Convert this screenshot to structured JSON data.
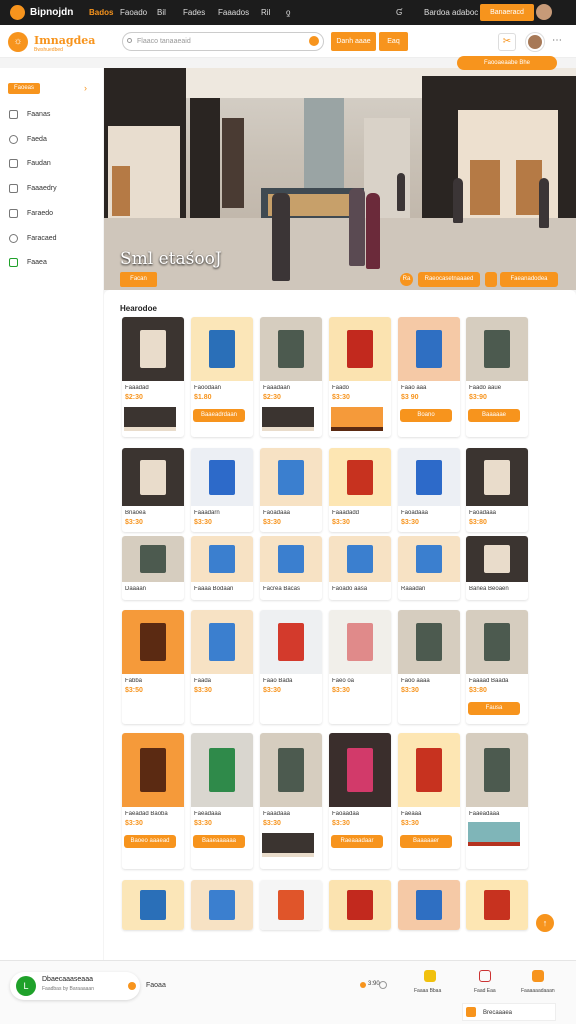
{
  "topbar": {
    "brand": "Bipnojdn",
    "nav": [
      "Bados",
      "Faoado",
      "Bil",
      "Fades",
      "Faaados",
      "Ril",
      "ƍ"
    ],
    "search_hint": "Ɠ",
    "link": "Bardoa adaboc",
    "action": "Banaeracd"
  },
  "header": {
    "title": "Imnagdea",
    "subtitle": "Bwshuedbed",
    "search_placeholder": "Flaaco tanaaeaid",
    "button1": "Danh aaae",
    "button2": "Eaq"
  },
  "sidebar": {
    "category": "Faoeas",
    "items": [
      "Faanas",
      "Faeda",
      "Faudan",
      "Faaaedry",
      "Faraedo",
      "Faracaed",
      "Faaea"
    ]
  },
  "hero": {
    "title": "Sml etaśooJ",
    "button": "Facan",
    "top_pill": "Faooaeaabe Bhe",
    "nav_label": "Ra",
    "button2": "Raeocasetnaaaed",
    "button3": "Faeanadodea"
  },
  "products": {
    "section_title": "Hearodoe",
    "rows": [
      [
        {
          "name": "Faaadad",
          "price": "$2:30",
          "img": "store",
          "thumb": "store"
        },
        {
          "name": "Faoodaan",
          "price": "$1.80",
          "img": "phone",
          "btn": "Baaeadrdaan"
        },
        {
          "name": "Faaadaan",
          "price": "$2:30",
          "img": "mall",
          "thumb": "store"
        },
        {
          "name": "Faado",
          "price": "$3:30",
          "img": "box",
          "thumb": "sign"
        },
        {
          "name": "Faao aaa",
          "price": "$3 90",
          "img": "game",
          "btn": "Boano"
        },
        {
          "name": "Faado aaue",
          "price": "$3:90",
          "img": "mall",
          "btn": "Baaaaae"
        }
      ],
      [
        {
          "name": "Bnaoea",
          "price": "$3:30",
          "img": "store"
        },
        {
          "name": "Faaadarn",
          "price": "$3:30",
          "img": "card"
        },
        {
          "name": "Faoadaaa",
          "price": "$3:30",
          "img": "book"
        },
        {
          "name": "Faaadadd",
          "price": "$3:30",
          "img": "cube"
        },
        {
          "name": "Faoadaaa",
          "price": "$3:30",
          "img": "card"
        },
        {
          "name": "Faoadaaa",
          "price": "$3:80",
          "img": "store"
        }
      ],
      [
        {
          "name": "Daaaan",
          "price": "",
          "img": "mall"
        },
        {
          "name": "Faaaa Bodaan",
          "price": "",
          "img": "book"
        },
        {
          "name": "Facrea Bacas",
          "price": "",
          "img": "book"
        },
        {
          "name": "Faoado aasa",
          "price": "",
          "img": "book"
        },
        {
          "name": "Raaadan",
          "price": "",
          "img": "book"
        },
        {
          "name": "Banea Beoaen",
          "price": "",
          "img": "store"
        }
      ],
      [
        {
          "name": "Fabba",
          "price": "$3:50",
          "img": "sign"
        },
        {
          "name": "Faada",
          "price": "$3:30",
          "img": "book"
        },
        {
          "name": "Faao Bada",
          "price": "$3:30",
          "img": "toy"
        },
        {
          "name": "Faeo oa",
          "price": "$3:30",
          "img": "kids"
        },
        {
          "name": "Faoo aaaa",
          "price": "$3:30",
          "img": "mall"
        },
        {
          "name": "Faaaad Baada",
          "price": "$3:80",
          "img": "mall",
          "btn": "Fausa"
        }
      ],
      [
        {
          "name": "Faeadad Baoba",
          "price": "$3:30",
          "img": "sign",
          "btn": "Baoeo aaaead"
        },
        {
          "name": "Faeadaaa",
          "price": "$3:30",
          "img": "gift",
          "btn": "Baaeaaaaaa"
        },
        {
          "name": "Faaadaaa",
          "price": "$3:30",
          "img": "mall",
          "thumb": "store"
        },
        {
          "name": "Faoaadaa",
          "price": "$3:30",
          "img": "display",
          "btn": "Raeaaadaar"
        },
        {
          "name": "Faeaaa",
          "price": "$3:30",
          "img": "cube",
          "btn": "Baaaaaer"
        },
        {
          "name": "Faaeadaaa",
          "price": "",
          "img": "mall",
          "thumb": "kiosk"
        }
      ],
      [
        {
          "name": "",
          "price": "",
          "img": "phone"
        },
        {
          "name": "",
          "price": "",
          "img": "book"
        },
        {
          "name": "",
          "price": "",
          "img": "bag"
        },
        {
          "name": "",
          "price": "",
          "img": "box"
        },
        {
          "name": "",
          "price": "",
          "img": "game"
        },
        {
          "name": "",
          "price": "",
          "img": "cube"
        }
      ]
    ]
  },
  "footer": {
    "chat_initial": "L",
    "chat_name": "Dbaecaaaseaaa",
    "chat_sub": "Faadbas by Baraaaaan",
    "label": "Faoaa",
    "rating": "3:90",
    "item1": "Faaaa Bbaa",
    "item2": "Faad Eaa",
    "item3": "Faaaaaadaaan",
    "pill": "Brecaaaea"
  },
  "colors": {
    "accent": "#f7941d",
    "dark": "#1c1c1c"
  }
}
